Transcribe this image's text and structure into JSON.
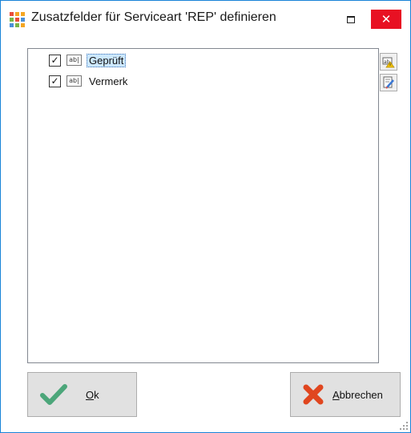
{
  "window": {
    "title": "Zusatzfelder für Serviceart 'REP' definieren",
    "icon": "app-grid-icon",
    "close_glyph": "✕",
    "maximize_icon": "maximize-icon"
  },
  "list": {
    "items": [
      {
        "label": "Geprüft",
        "checked": true,
        "checkmark": "✓",
        "type_badge": "ab|",
        "selected": true
      },
      {
        "label": "Vermerk",
        "checked": true,
        "checkmark": "✓",
        "type_badge": "ab|",
        "selected": false
      }
    ]
  },
  "side_buttons": [
    {
      "icon": "add-field-icon"
    },
    {
      "icon": "edit-field-icon"
    }
  ],
  "buttons": {
    "ok": {
      "label_first": "O",
      "label_rest": "k",
      "icon": "checkmark-icon"
    },
    "cancel": {
      "label_first": "A",
      "label_rest": "bbrechen",
      "icon": "cross-icon"
    }
  },
  "colors": {
    "close_red": "#e81123",
    "ok_green": "#4ca67a",
    "cancel_red": "#e0461f",
    "selection": "#cce8ff"
  }
}
